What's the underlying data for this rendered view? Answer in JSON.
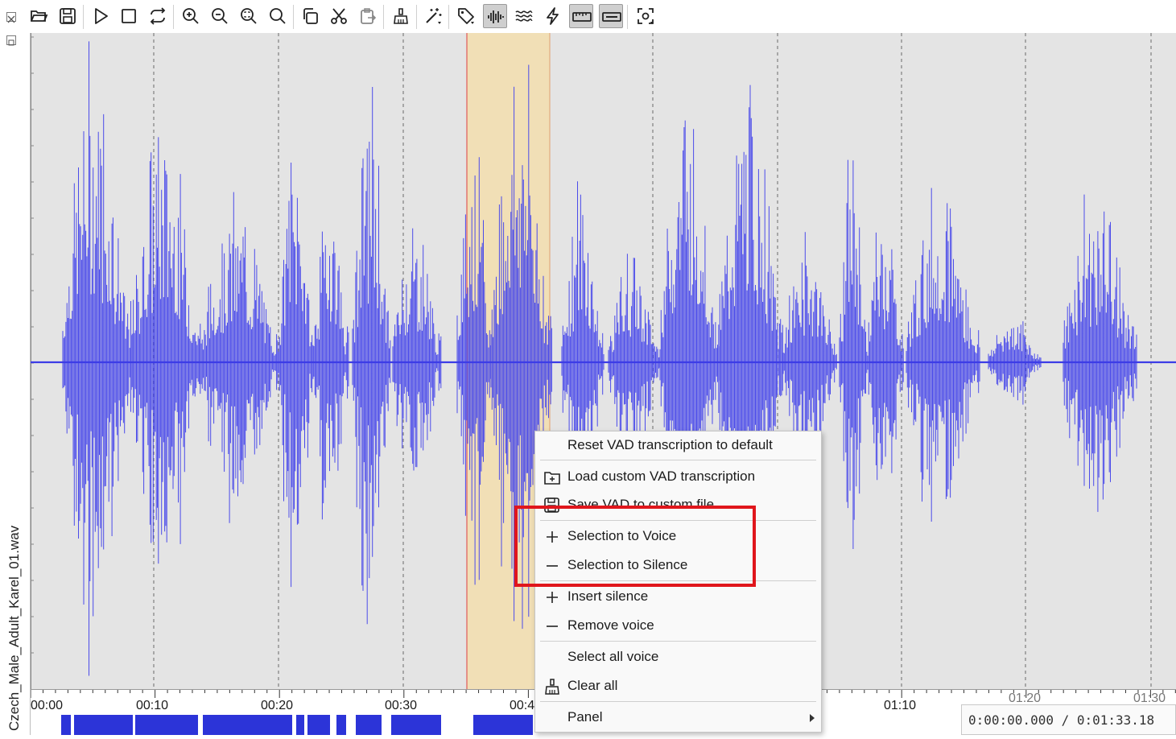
{
  "toolbar": {
    "buttons": [
      {
        "name": "open-file",
        "icon": "folder-open-icon"
      },
      {
        "name": "save",
        "icon": "save-icon"
      },
      {
        "name": "play",
        "icon": "play-icon"
      },
      {
        "name": "stop",
        "icon": "stop-icon"
      },
      {
        "name": "loop",
        "icon": "loop-icon"
      },
      {
        "name": "zoom-in",
        "icon": "zoom-in-icon"
      },
      {
        "name": "zoom-out",
        "icon": "zoom-out-icon"
      },
      {
        "name": "zoom-selection",
        "icon": "zoom-selection-icon"
      },
      {
        "name": "zoom-fit",
        "icon": "zoom-fit-icon"
      },
      {
        "name": "copy",
        "icon": "copy-icon"
      },
      {
        "name": "cut",
        "icon": "scissors-icon"
      },
      {
        "name": "paste",
        "icon": "paste-icon"
      },
      {
        "name": "clear",
        "icon": "broom-icon"
      },
      {
        "name": "magic-wand",
        "icon": "magic-wand-icon"
      },
      {
        "name": "tag",
        "icon": "tag-icon"
      },
      {
        "name": "waveform-view",
        "icon": "waveform-icon"
      },
      {
        "name": "spectrum-view",
        "icon": "waves-icon"
      },
      {
        "name": "flash",
        "icon": "lightning-icon"
      },
      {
        "name": "ruler",
        "icon": "ruler-icon"
      },
      {
        "name": "vad-lane",
        "icon": "vad-lane-icon"
      },
      {
        "name": "focus",
        "icon": "focus-icon"
      }
    ]
  },
  "track": {
    "name": "Czech_Male_Adult_Karel_01.wav"
  },
  "timeline": {
    "ticks": [
      "00:00",
      "00:10",
      "00:20",
      "00:30",
      "00:4",
      "01:10",
      "01:20",
      "01:30"
    ]
  },
  "time_readout": "0:00:00.000 / 0:01:33.18",
  "colors": {
    "waveform": "#4b4bea",
    "selection": "#f1dfb6",
    "vad_voice": "#2c34d8",
    "highlight": "#e0161c"
  },
  "context_menu": {
    "items": [
      {
        "label": "Reset VAD transcription to default",
        "icon": ""
      },
      {
        "label": "Load custom VAD transcription",
        "icon": "folder-open-icon"
      },
      {
        "label": "Save VAD to custom file ..",
        "icon": "save-icon"
      },
      {
        "label": "Selection to Voice",
        "icon": "plus-icon"
      },
      {
        "label": "Selection to Silence",
        "icon": "minus-icon"
      },
      {
        "label": "Insert silence",
        "icon": "plus-icon"
      },
      {
        "label": "Remove voice",
        "icon": "minus-icon"
      },
      {
        "label": "Select all voice",
        "icon": ""
      },
      {
        "label": "Clear all",
        "icon": "broom-icon"
      },
      {
        "label": "Panel",
        "icon": ""
      }
    ]
  }
}
